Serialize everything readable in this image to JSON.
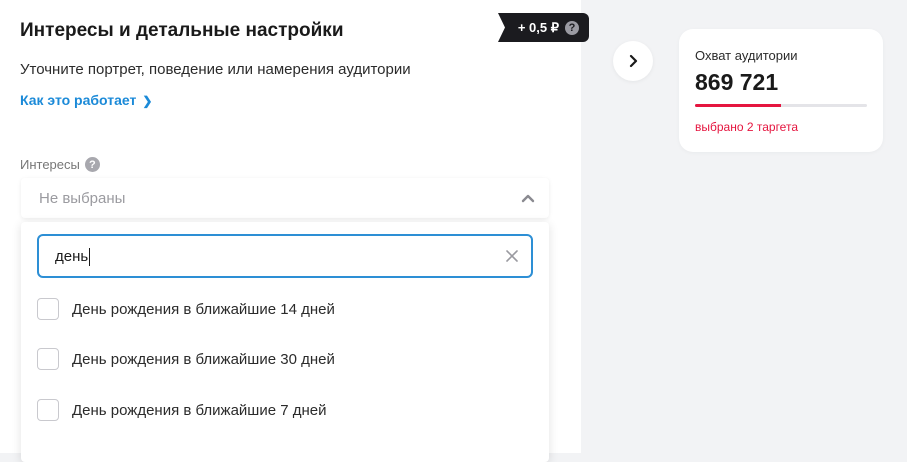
{
  "section": {
    "title": "Интересы и детальные настройки",
    "price_badge": "+ 0,5 ₽",
    "price_help": "?",
    "subtitle": "Уточните портрет, поведение или намерения аудитории",
    "how_link": "Как это работает"
  },
  "interests": {
    "label": "Интересы",
    "help": "?",
    "select_value": "Не выбраны",
    "search_value": "день",
    "options": [
      {
        "label": "День рождения в ближайшие 14 дней",
        "checked": false
      },
      {
        "label": "День рождения в ближайшие 30 дней",
        "checked": false
      },
      {
        "label": "День рождения в ближайшие 7 дней",
        "checked": false
      }
    ]
  },
  "reach": {
    "title": "Охват аудитории",
    "value": "869 721",
    "progress_fraction": 0.5,
    "note": "выбрано 2 таргета"
  },
  "colors": {
    "accent_link": "#1b8ad8",
    "focus_border": "#2d8fd5",
    "progress_fill": "#e5153f",
    "note_text": "#e5153f",
    "badge_bg": "#1b1b1f"
  },
  "icons": {
    "price_help": "question-circle-icon",
    "interests_help": "question-circle-icon",
    "select_toggle": "chevron-up-icon",
    "link_chevron": "chevron-right-icon",
    "clear": "close-icon",
    "nav": "chevron-right-icon"
  }
}
